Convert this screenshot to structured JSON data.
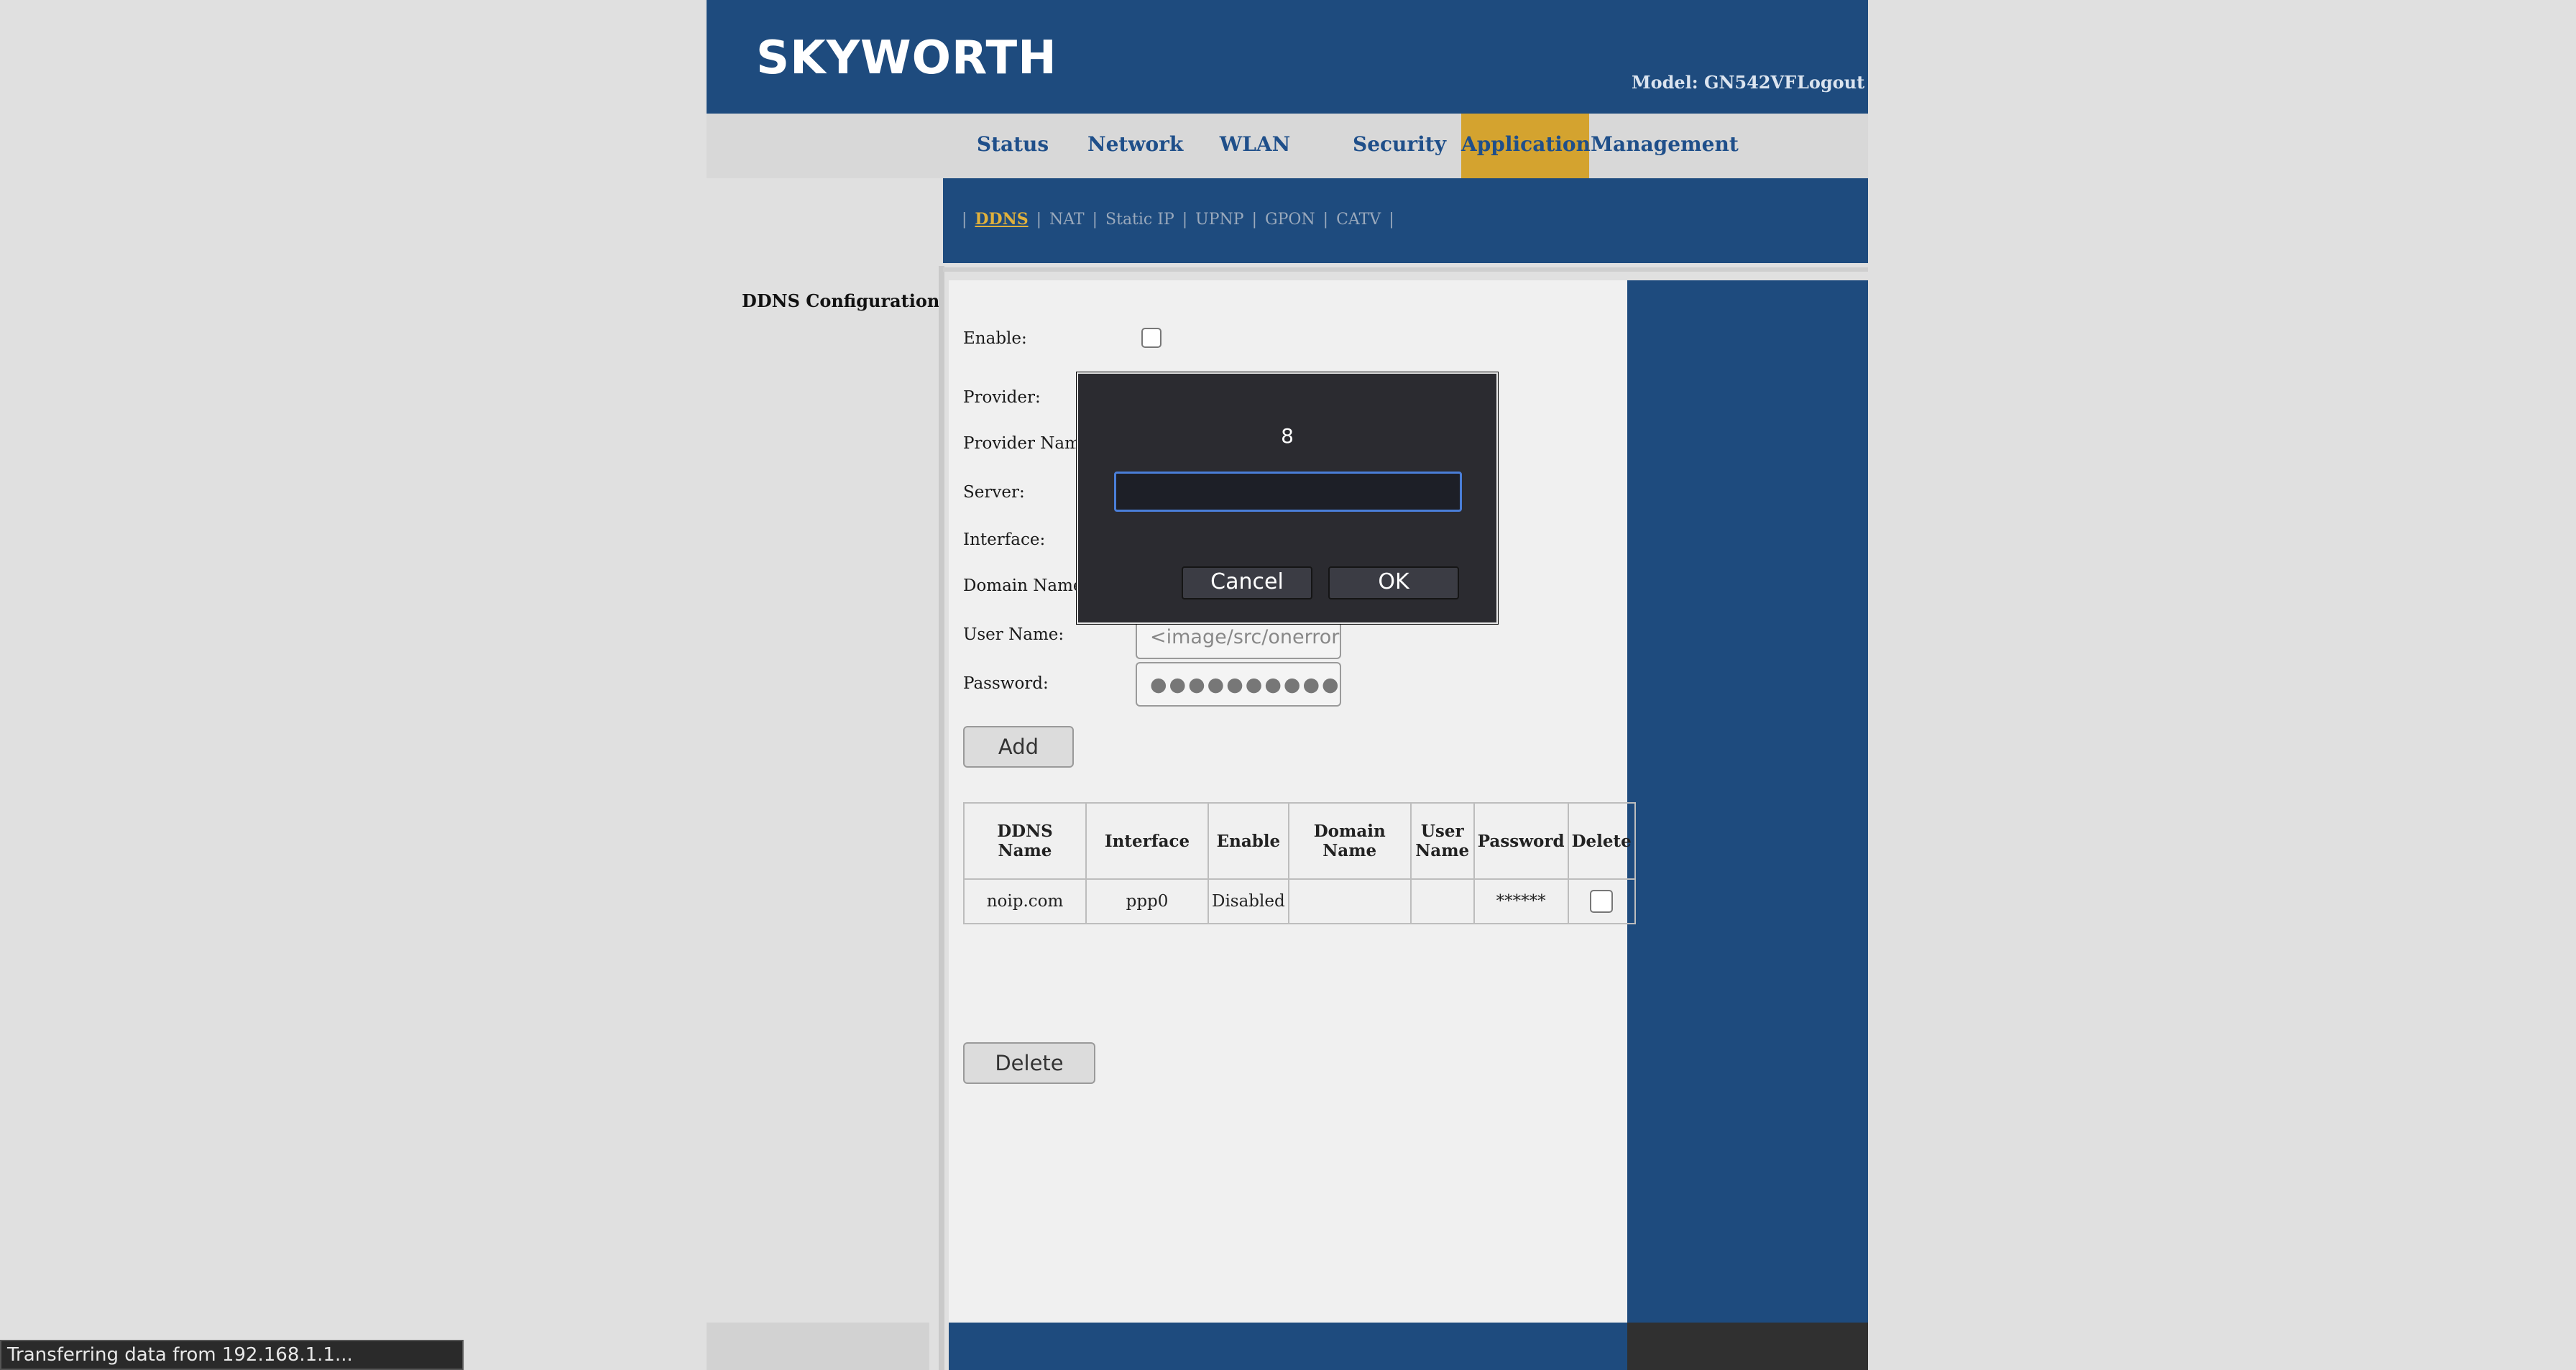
{
  "header": {
    "brand": "SKYWORTH",
    "model": "Model: GN542VF",
    "logout": "Logout"
  },
  "nav": {
    "items": [
      "Status",
      "Network",
      "WLAN",
      "Security",
      "Application",
      "Management"
    ],
    "active": "Application"
  },
  "subnav": {
    "items": [
      "DDNS",
      "NAT",
      "Static IP",
      "UPNP",
      "GPON",
      "CATV"
    ],
    "active": "DDNS",
    "separator": "|"
  },
  "sidebar": {
    "title": "DDNS Configuration"
  },
  "form": {
    "enable_label": "Enable:",
    "provider_label": "Provider:",
    "provider_name_label": "Provider Name:",
    "server_label": "Server:",
    "interface_label": "Interface:",
    "domain_name_label": "Domain Name:",
    "user_name_label": "User Name:",
    "user_name_value": "<image/src/onerror",
    "password_label": "Password:",
    "password_value": "●●●●●●●●●●●●●",
    "add_button": "Add",
    "delete_button": "Delete"
  },
  "table": {
    "headers": [
      "DDNS Name",
      "Interface",
      "Enable",
      "Domain Name",
      "User Name",
      "Password",
      "Delete"
    ],
    "rows": [
      [
        "noip.com",
        "ppp0",
        "Disabled",
        "",
        "",
        "******"
      ]
    ]
  },
  "dialog": {
    "message": "8",
    "input_value": "",
    "cancel": "Cancel",
    "ok": "OK"
  },
  "statusbar": {
    "text": "Transferring data from 192.168.1.1..."
  },
  "colors": {
    "header_blue": "#1e4b7e",
    "active_tab": "#d4a32f",
    "subnav_active": "#e0b13c"
  }
}
